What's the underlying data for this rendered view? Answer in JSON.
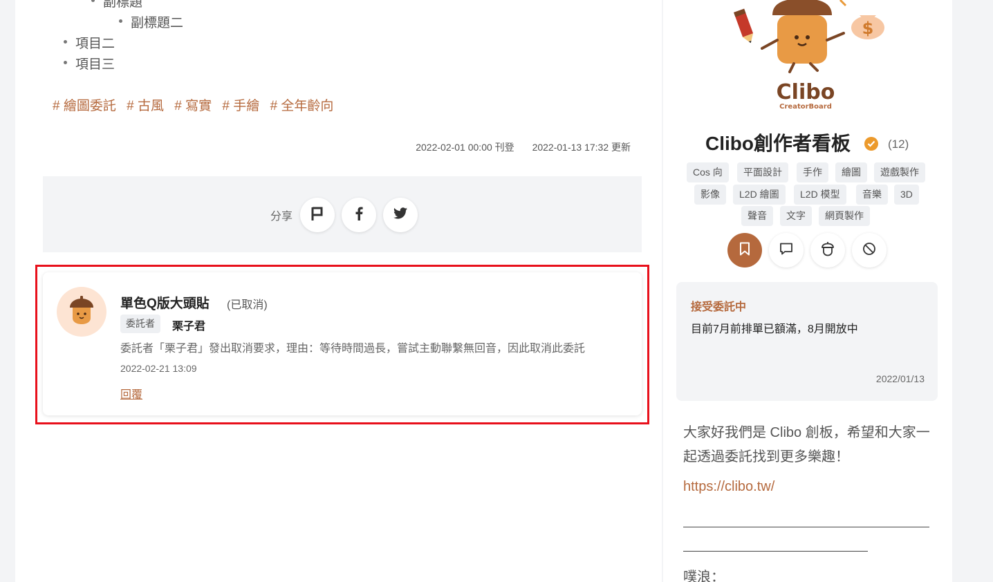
{
  "article": {
    "bullets": [
      {
        "text": "副標題",
        "level": 2
      },
      {
        "text": "副標題二",
        "level": 3
      },
      {
        "text": "項目二",
        "level": 1
      },
      {
        "text": "項目三",
        "level": 1
      }
    ],
    "hashtags": [
      "# 繪圖委託",
      "# 古風",
      "# 寫實",
      "# 手繪",
      "# 全年齡向"
    ],
    "published": "2022-02-01 00:00 刊登",
    "updated": "2022-01-13 17:32 更新"
  },
  "share": {
    "label": "分享",
    "buttons": [
      "report-flag-icon",
      "facebook-icon",
      "twitter-icon"
    ]
  },
  "comment": {
    "title": "單色Q版大頭貼",
    "status": "(已取消)",
    "role": "委託者",
    "name": "栗子君",
    "text": "委託者「栗子君」發出取消要求，理由：等待時間過長，嘗試主動聯繫無回音，因此取消此委託",
    "time": "2022-02-21 13:09",
    "reply": "回覆"
  },
  "profile": {
    "logo_text": "Clibo",
    "logo_subtext": "CreatorBoard",
    "name": "Clibo創作者看板",
    "count": "(12)",
    "categories": [
      [
        "Cos 向",
        "平面設計",
        "手作",
        "繪圖",
        "遊戲製作"
      ],
      [
        "影像",
        "L2D 繪圖",
        "L2D 模型",
        "音樂",
        "3D"
      ],
      [
        "聲音",
        "文字",
        "網頁製作"
      ]
    ],
    "actions": [
      "bookmark-icon",
      "message-icon",
      "acorn-icon",
      "block-icon"
    ]
  },
  "notice": {
    "title": "接受委託中",
    "text": "目前7月前排單已額滿，8月開放中",
    "date": "2022/01/13"
  },
  "intro": {
    "text": "大家好我們是 Clibo 創板，希望和大家一起透過委託找到更多樂趣！",
    "link": "https://clibo.tw/",
    "plurk_label": "噗浪："
  },
  "colors": {
    "accent": "#b5693d",
    "highlight": "#e8101b",
    "background": "#f3f4f6"
  }
}
